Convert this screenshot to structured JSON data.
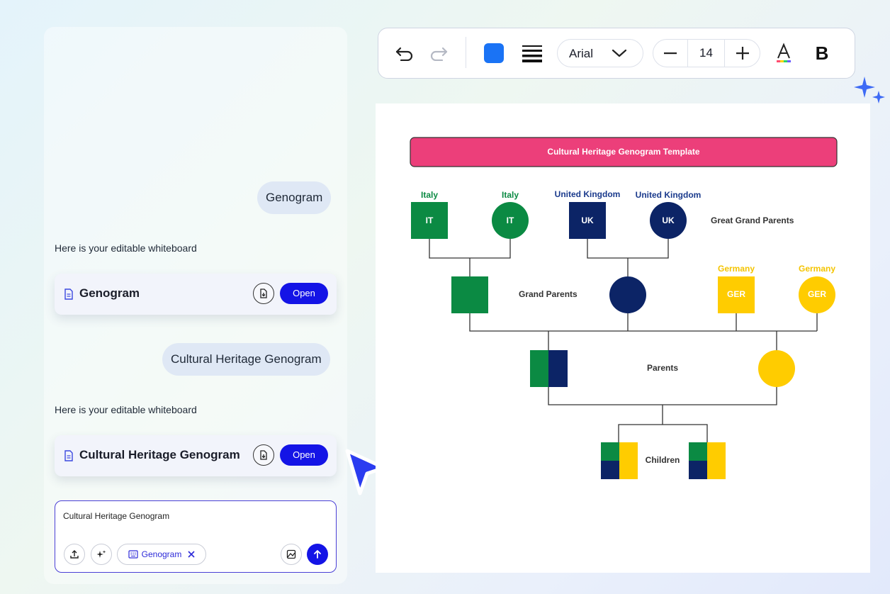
{
  "chat": {
    "messages": [
      {
        "role": "user",
        "text": "Genogram"
      },
      {
        "role": "assistant",
        "text": "Here is your editable whiteboard",
        "card": {
          "title": "Genogram",
          "open_label": "Open"
        }
      },
      {
        "role": "user",
        "text": "Cultural Heritage Genogram"
      },
      {
        "role": "assistant",
        "text": "Here is your editable whiteboard",
        "card": {
          "title": "Cultural Heritage Genogram",
          "open_label": "Open"
        }
      }
    ],
    "input": {
      "value": "Cultural Heritage Genogram",
      "chip_label": "Genogram"
    }
  },
  "toolbar": {
    "font_name": "Arial",
    "font_size": "14",
    "bold_label": "B",
    "color_swatch": "#1a73f5"
  },
  "diagram": {
    "title": "Cultural Heritage Genogram Template",
    "great_grand_parents": {
      "label": "Great Grand Parents",
      "members": [
        {
          "country": "Italy",
          "code": "IT",
          "shape": "square"
        },
        {
          "country": "Italy",
          "code": "IT",
          "shape": "circle"
        },
        {
          "country": "United Kingdom",
          "code": "UK",
          "shape": "square"
        },
        {
          "country": "United Kingdom",
          "code": "UK",
          "shape": "circle"
        }
      ]
    },
    "grand_parents": {
      "label": "Grand Parents",
      "members": [
        {
          "country": "Germany",
          "code": "GER",
          "shape": "square"
        },
        {
          "country": "Germany",
          "code": "GER",
          "shape": "circle"
        }
      ]
    },
    "parents_label": "Parents",
    "children_label": "Children",
    "colors": {
      "italy": "#0b8a43",
      "uk": "#0c2466",
      "germany": "#ffcc00",
      "title_bar": "#ec3f7a",
      "italy_label": "#0b8a43",
      "uk_label": "#1a3a8c",
      "germany_label": "#f4c400"
    }
  },
  "colors": {
    "accent": "#1414e6"
  }
}
